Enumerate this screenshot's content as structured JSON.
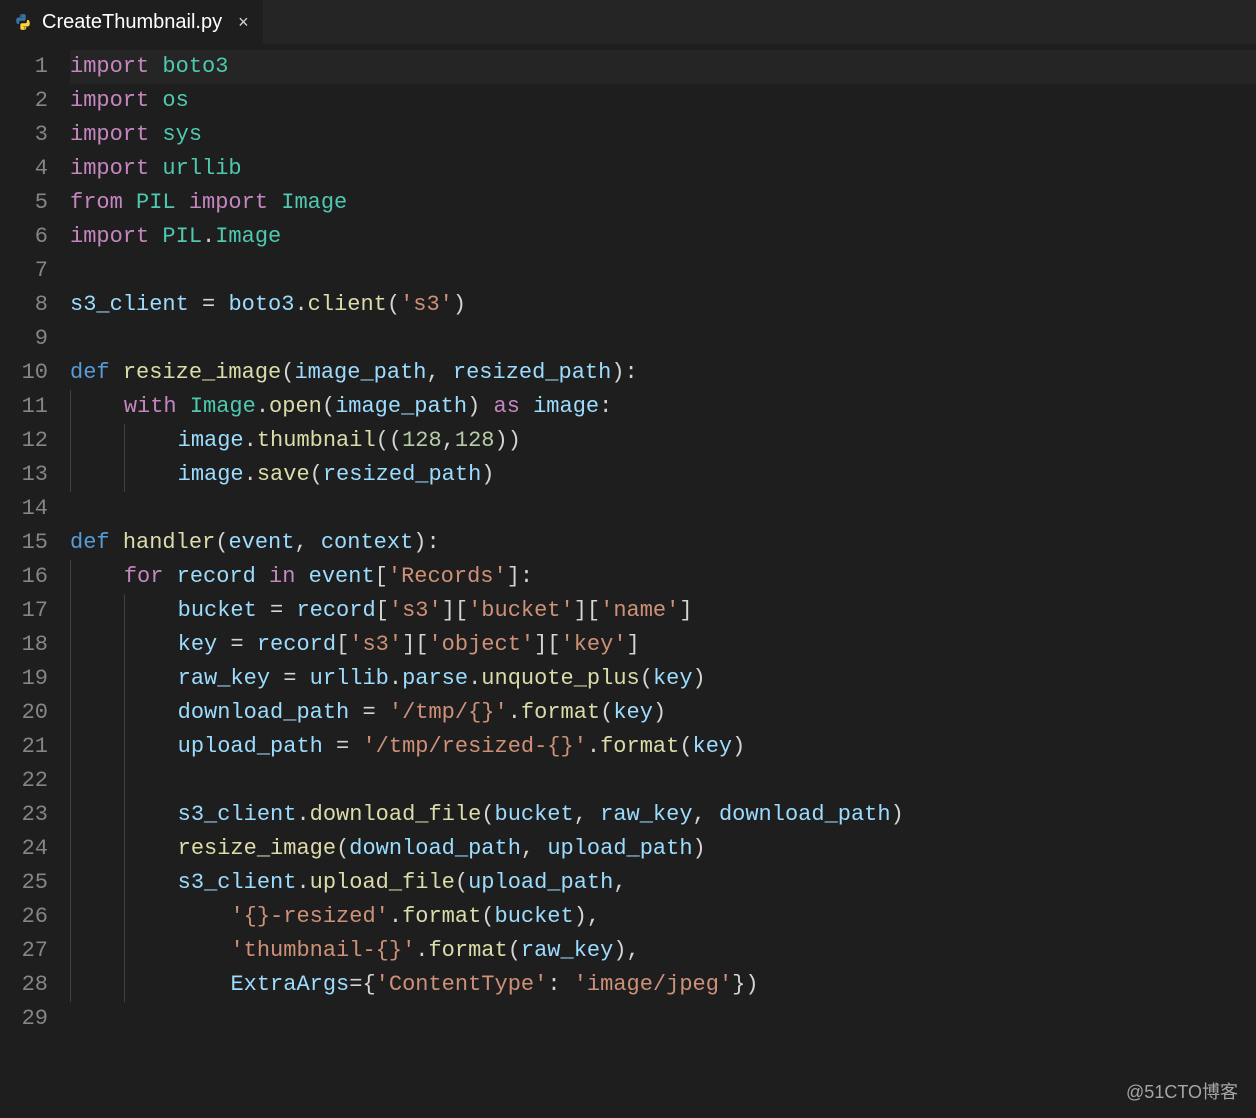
{
  "tab": {
    "filename": "CreateThumbnail.py",
    "icon": "python-icon",
    "close_glyph": "×"
  },
  "watermark": "@51CTO博客",
  "line_count": 29,
  "code": {
    "l1": {
      "t": [
        [
          "kw",
          "import"
        ],
        [
          "op",
          " "
        ],
        [
          "mod",
          "boto3"
        ]
      ]
    },
    "l2": {
      "t": [
        [
          "kw",
          "import"
        ],
        [
          "op",
          " "
        ],
        [
          "mod",
          "os"
        ]
      ]
    },
    "l3": {
      "t": [
        [
          "kw",
          "import"
        ],
        [
          "op",
          " "
        ],
        [
          "mod",
          "sys"
        ]
      ]
    },
    "l4": {
      "t": [
        [
          "kw",
          "import"
        ],
        [
          "op",
          " "
        ],
        [
          "mod",
          "urllib"
        ]
      ]
    },
    "l5": {
      "t": [
        [
          "kw",
          "from"
        ],
        [
          "op",
          " "
        ],
        [
          "mod",
          "PIL"
        ],
        [
          "op",
          " "
        ],
        [
          "kw",
          "import"
        ],
        [
          "op",
          " "
        ],
        [
          "cls",
          "Image"
        ]
      ]
    },
    "l6": {
      "t": [
        [
          "kw",
          "import"
        ],
        [
          "op",
          " "
        ],
        [
          "mod",
          "PIL"
        ],
        [
          "pn",
          "."
        ],
        [
          "cls",
          "Image"
        ]
      ]
    },
    "l7": {
      "t": []
    },
    "l8": {
      "t": [
        [
          "var",
          "s3_client"
        ],
        [
          "op",
          " = "
        ],
        [
          "var",
          "boto3"
        ],
        [
          "pn",
          "."
        ],
        [
          "fn",
          "client"
        ],
        [
          "pn",
          "("
        ],
        [
          "str",
          "'s3'"
        ],
        [
          "pn",
          ")"
        ]
      ]
    },
    "l9": {
      "t": []
    },
    "l10": {
      "t": [
        [
          "kw2",
          "def"
        ],
        [
          "op",
          " "
        ],
        [
          "fn",
          "resize_image"
        ],
        [
          "pn",
          "("
        ],
        [
          "prm",
          "image_path"
        ],
        [
          "pn",
          ", "
        ],
        [
          "prm",
          "resized_path"
        ],
        [
          "pn",
          ")"
        ],
        [
          "pn",
          ":"
        ]
      ]
    },
    "l11": {
      "indent": 1,
      "t": [
        [
          "kw",
          "with"
        ],
        [
          "op",
          " "
        ],
        [
          "cls",
          "Image"
        ],
        [
          "pn",
          "."
        ],
        [
          "fn",
          "open"
        ],
        [
          "pn",
          "("
        ],
        [
          "var",
          "image_path"
        ],
        [
          "pn",
          ")"
        ],
        [
          "op",
          " "
        ],
        [
          "kw",
          "as"
        ],
        [
          "op",
          " "
        ],
        [
          "var",
          "image"
        ],
        [
          "pn",
          ":"
        ]
      ]
    },
    "l12": {
      "indent": 2,
      "t": [
        [
          "var",
          "image"
        ],
        [
          "pn",
          "."
        ],
        [
          "fn",
          "thumbnail"
        ],
        [
          "pn",
          "(("
        ],
        [
          "num",
          "128"
        ],
        [
          "pn",
          ","
        ],
        [
          "num",
          "128"
        ],
        [
          "pn",
          "))"
        ]
      ]
    },
    "l13": {
      "indent": 2,
      "t": [
        [
          "var",
          "image"
        ],
        [
          "pn",
          "."
        ],
        [
          "fn",
          "save"
        ],
        [
          "pn",
          "("
        ],
        [
          "var",
          "resized_path"
        ],
        [
          "pn",
          ")"
        ]
      ]
    },
    "l14": {
      "t": []
    },
    "l15": {
      "t": [
        [
          "kw2",
          "def"
        ],
        [
          "op",
          " "
        ],
        [
          "fn",
          "handler"
        ],
        [
          "pn",
          "("
        ],
        [
          "prm",
          "event"
        ],
        [
          "pn",
          ", "
        ],
        [
          "prm",
          "context"
        ],
        [
          "pn",
          ")"
        ],
        [
          "pn",
          ":"
        ]
      ]
    },
    "l16": {
      "indent": 1,
      "t": [
        [
          "kw",
          "for"
        ],
        [
          "op",
          " "
        ],
        [
          "var",
          "record"
        ],
        [
          "op",
          " "
        ],
        [
          "kw",
          "in"
        ],
        [
          "op",
          " "
        ],
        [
          "var",
          "event"
        ],
        [
          "pn",
          "["
        ],
        [
          "str",
          "'Records'"
        ],
        [
          "pn",
          "]"
        ],
        [
          "pn",
          ":"
        ]
      ]
    },
    "l17": {
      "indent": 2,
      "t": [
        [
          "var",
          "bucket"
        ],
        [
          "op",
          " = "
        ],
        [
          "var",
          "record"
        ],
        [
          "pn",
          "["
        ],
        [
          "str",
          "'s3'"
        ],
        [
          "pn",
          "]["
        ],
        [
          "str",
          "'bucket'"
        ],
        [
          "pn",
          "]["
        ],
        [
          "str",
          "'name'"
        ],
        [
          "pn",
          "]"
        ]
      ]
    },
    "l18": {
      "indent": 2,
      "t": [
        [
          "var",
          "key"
        ],
        [
          "op",
          " = "
        ],
        [
          "var",
          "record"
        ],
        [
          "pn",
          "["
        ],
        [
          "str",
          "'s3'"
        ],
        [
          "pn",
          "]["
        ],
        [
          "str",
          "'object'"
        ],
        [
          "pn",
          "]["
        ],
        [
          "str",
          "'key'"
        ],
        [
          "pn",
          "]"
        ]
      ]
    },
    "l19": {
      "indent": 2,
      "t": [
        [
          "var",
          "raw_key"
        ],
        [
          "op",
          " = "
        ],
        [
          "var",
          "urllib"
        ],
        [
          "pn",
          "."
        ],
        [
          "var",
          "parse"
        ],
        [
          "pn",
          "."
        ],
        [
          "fn",
          "unquote_plus"
        ],
        [
          "pn",
          "("
        ],
        [
          "var",
          "key"
        ],
        [
          "pn",
          ")"
        ]
      ]
    },
    "l20": {
      "indent": 2,
      "t": [
        [
          "var",
          "download_path"
        ],
        [
          "op",
          " = "
        ],
        [
          "str",
          "'/tmp/{}'"
        ],
        [
          "pn",
          "."
        ],
        [
          "fn",
          "format"
        ],
        [
          "pn",
          "("
        ],
        [
          "var",
          "key"
        ],
        [
          "pn",
          ")"
        ]
      ]
    },
    "l21": {
      "indent": 2,
      "t": [
        [
          "var",
          "upload_path"
        ],
        [
          "op",
          " = "
        ],
        [
          "str",
          "'/tmp/resized-{}'"
        ],
        [
          "pn",
          "."
        ],
        [
          "fn",
          "format"
        ],
        [
          "pn",
          "("
        ],
        [
          "var",
          "key"
        ],
        [
          "pn",
          ")"
        ]
      ]
    },
    "l22": {
      "indent": 2,
      "t": []
    },
    "l23": {
      "indent": 2,
      "t": [
        [
          "var",
          "s3_client"
        ],
        [
          "pn",
          "."
        ],
        [
          "fn",
          "download_file"
        ],
        [
          "pn",
          "("
        ],
        [
          "var",
          "bucket"
        ],
        [
          "pn",
          ", "
        ],
        [
          "var",
          "raw_key"
        ],
        [
          "pn",
          ", "
        ],
        [
          "var",
          "download_path"
        ],
        [
          "pn",
          ")"
        ]
      ]
    },
    "l24": {
      "indent": 2,
      "t": [
        [
          "fn",
          "resize_image"
        ],
        [
          "pn",
          "("
        ],
        [
          "var",
          "download_path"
        ],
        [
          "pn",
          ", "
        ],
        [
          "var",
          "upload_path"
        ],
        [
          "pn",
          ")"
        ]
      ]
    },
    "l25": {
      "indent": 2,
      "t": [
        [
          "var",
          "s3_client"
        ],
        [
          "pn",
          "."
        ],
        [
          "fn",
          "upload_file"
        ],
        [
          "pn",
          "("
        ],
        [
          "var",
          "upload_path"
        ],
        [
          "pn",
          ","
        ]
      ]
    },
    "l26": {
      "indent": 3,
      "t": [
        [
          "str",
          "'{}-resized'"
        ],
        [
          "pn",
          "."
        ],
        [
          "fn",
          "format"
        ],
        [
          "pn",
          "("
        ],
        [
          "var",
          "bucket"
        ],
        [
          "pn",
          "),"
        ]
      ]
    },
    "l27": {
      "indent": 3,
      "t": [
        [
          "str",
          "'thumbnail-{}'"
        ],
        [
          "pn",
          "."
        ],
        [
          "fn",
          "format"
        ],
        [
          "pn",
          "("
        ],
        [
          "var",
          "raw_key"
        ],
        [
          "pn",
          "),"
        ]
      ]
    },
    "l28": {
      "indent": 3,
      "t": [
        [
          "prm",
          "ExtraArgs"
        ],
        [
          "op",
          "="
        ],
        [
          "pn",
          "{"
        ],
        [
          "str",
          "'ContentType'"
        ],
        [
          "pn",
          ": "
        ],
        [
          "str",
          "'image/jpeg'"
        ],
        [
          "pn",
          "})"
        ]
      ]
    },
    "l29": {
      "t": []
    }
  }
}
